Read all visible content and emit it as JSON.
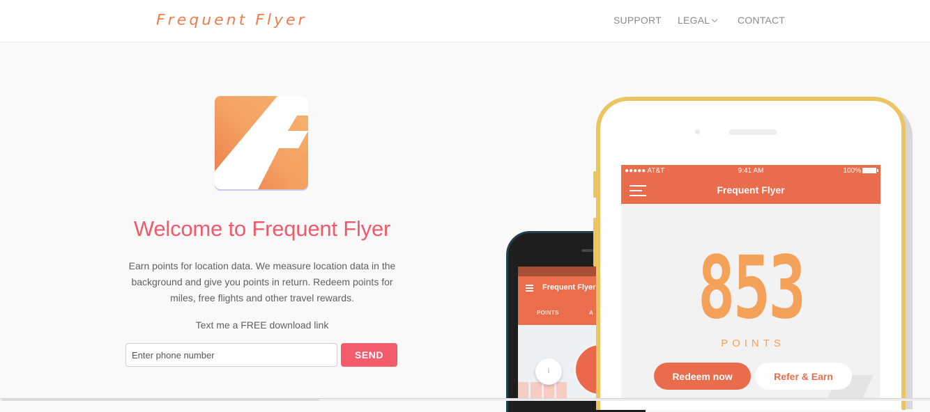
{
  "navbar": {
    "brand": "Frequent Flyer",
    "links": [
      {
        "label": "SUPPORT"
      },
      {
        "label": "LEGAL",
        "has_dropdown": true
      },
      {
        "label": "CONTACT"
      }
    ]
  },
  "hero": {
    "app_icon": "frequent-flyer-app-icon",
    "title": "Welcome to Frequent Flyer",
    "description": "Earn points for location data. We measure location data in the background and give you points in return. Redeem points for miles, free flights and other travel rewards.",
    "cta_text": "Text me a FREE download link",
    "phone_input": {
      "value": "",
      "placeholder": "Enter phone number"
    },
    "send_label": "SEND"
  },
  "phone_back": {
    "app_title": "Frequent Flyer",
    "tabs": [
      "POINTS",
      "A"
    ],
    "info_icon": "i"
  },
  "phone_front": {
    "status": {
      "carrier": "●●●●● AT&T",
      "time": "9:41 AM",
      "battery": "100%"
    },
    "app_title": "Frequent Flyer",
    "points_value": "853",
    "points_label": "POINTS",
    "redeem_label": "Redeem now",
    "refer_label": "Refer & Earn"
  },
  "colors": {
    "brand_orange": "#ee7d4e",
    "title_pink": "#f05a6a",
    "send_button": "#f45c6b",
    "app_bar": "#e96c4c",
    "points": "#f4a15a",
    "phone_frame": "#ecc462"
  }
}
